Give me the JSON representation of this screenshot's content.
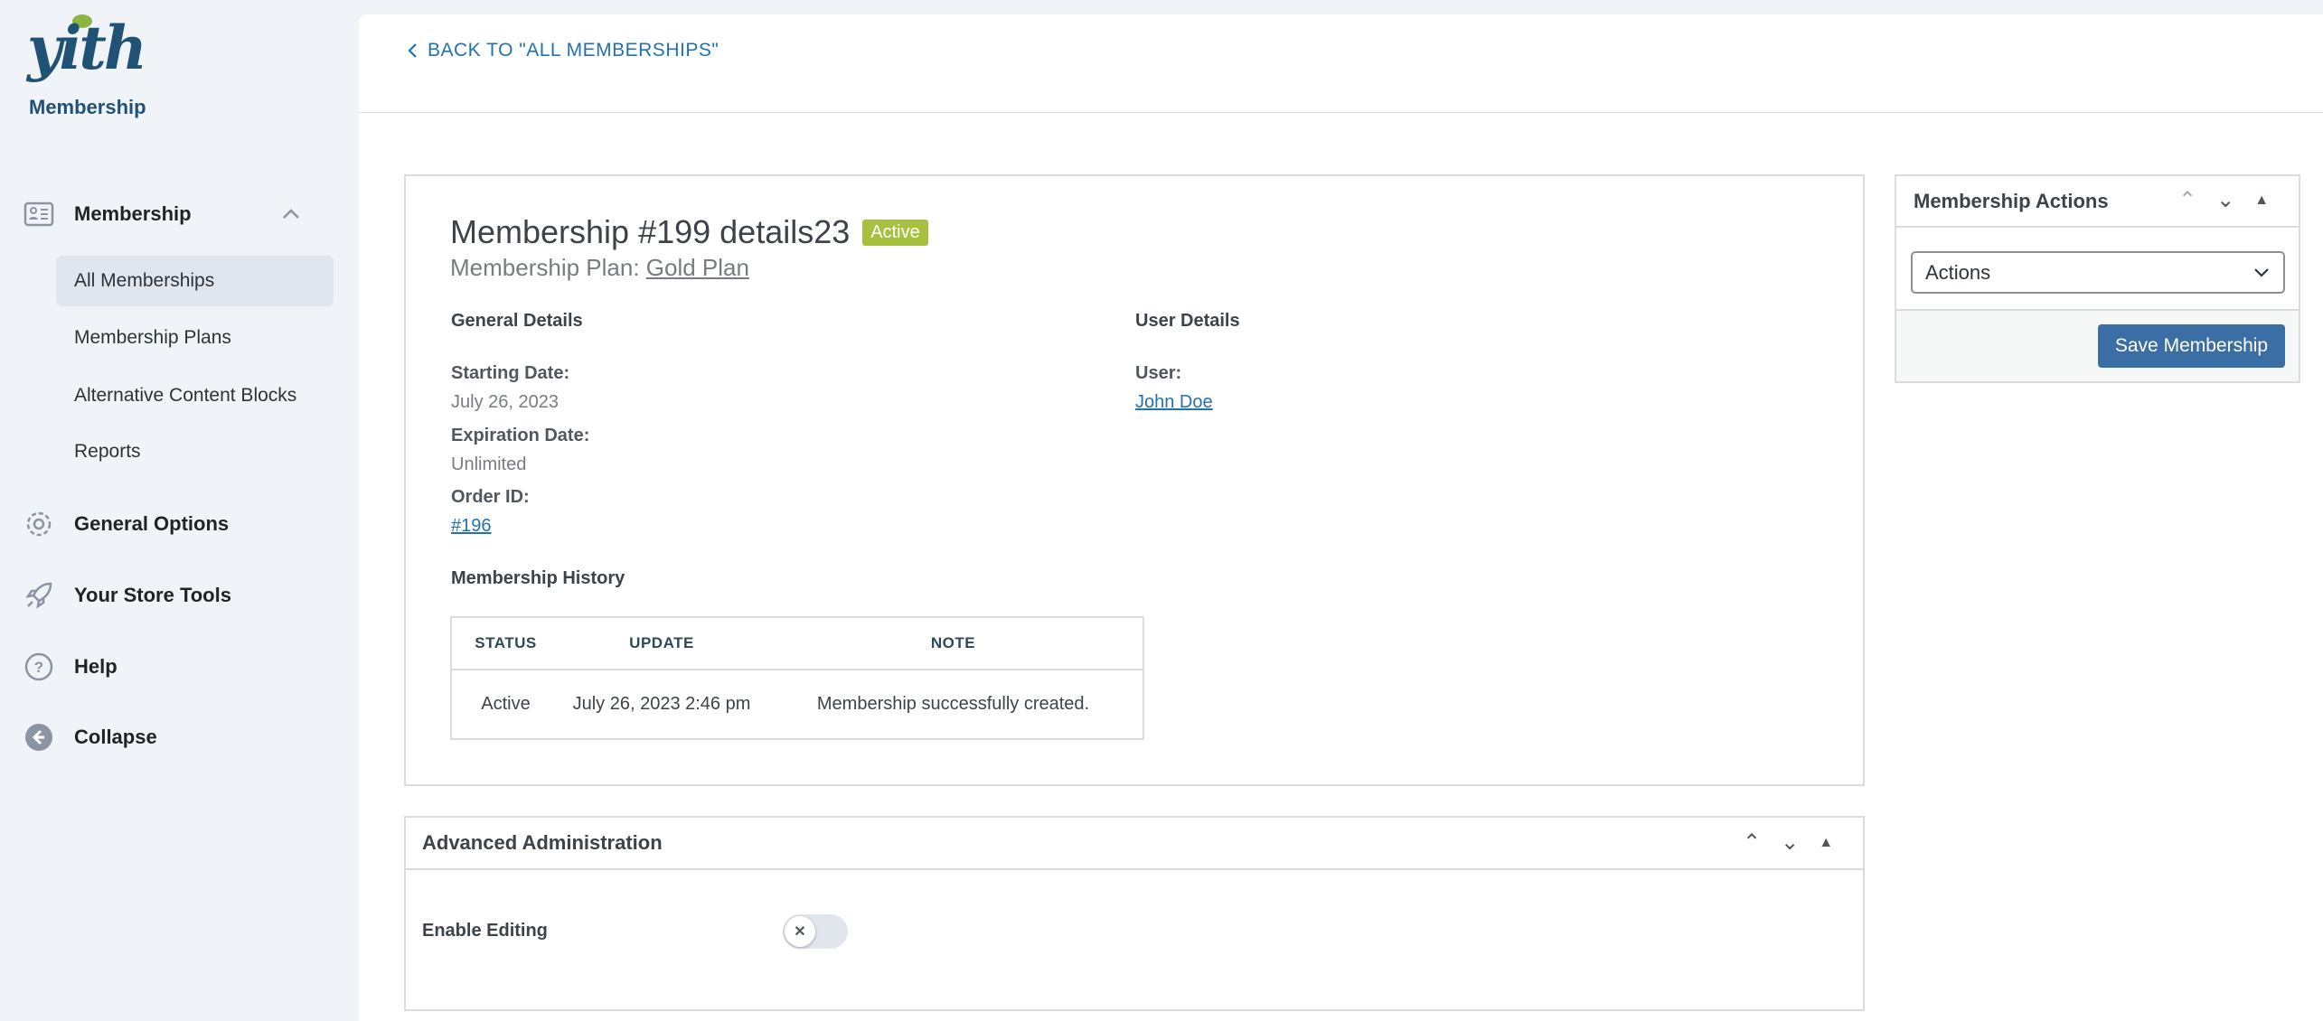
{
  "sidebar": {
    "logo_text": "yith",
    "brand": "Membership",
    "menu": [
      {
        "label": "Membership",
        "icon": "id-card-icon"
      },
      {
        "label": "General Options",
        "icon": "gear-icon"
      },
      {
        "label": "Your Store Tools",
        "icon": "rocket-icon"
      },
      {
        "label": "Help",
        "icon": "help-icon"
      },
      {
        "label": "Collapse",
        "icon": "collapse-icon"
      }
    ],
    "submenu": [
      "All Memberships",
      "Membership Plans",
      "Alternative Content Blocks",
      "Reports"
    ]
  },
  "header": {
    "back_link": "BACK TO \"ALL MEMBERSHIPS\""
  },
  "details": {
    "title": "Membership #199 details23",
    "status_badge": "Active",
    "plan_label": "Membership Plan:",
    "plan_name": "Gold Plan",
    "general_heading": "General Details",
    "starting_label": "Starting Date:",
    "starting_value": "July 26, 2023",
    "expiration_label": "Expiration Date:",
    "expiration_value": "Unlimited",
    "order_label": "Order ID:",
    "order_value": "#196",
    "user_heading": "User Details",
    "user_label": "User:",
    "user_value": "John Doe",
    "history_heading": "Membership History",
    "history": {
      "columns": [
        "STATUS",
        "UPDATE",
        "NOTE"
      ],
      "rows": [
        [
          "Active",
          "July 26, 2023 2:46 pm",
          "Membership successfully created."
        ]
      ]
    }
  },
  "advanced": {
    "title": "Advanced Administration",
    "enable_label": "Enable Editing",
    "enable_value": false
  },
  "actions": {
    "title": "Membership Actions",
    "select_value": "Actions",
    "save_label": "Save Membership"
  },
  "colors": {
    "accent": "#3a6ea5",
    "brand": "#1f5275",
    "active_badge": "#a5c13f"
  }
}
